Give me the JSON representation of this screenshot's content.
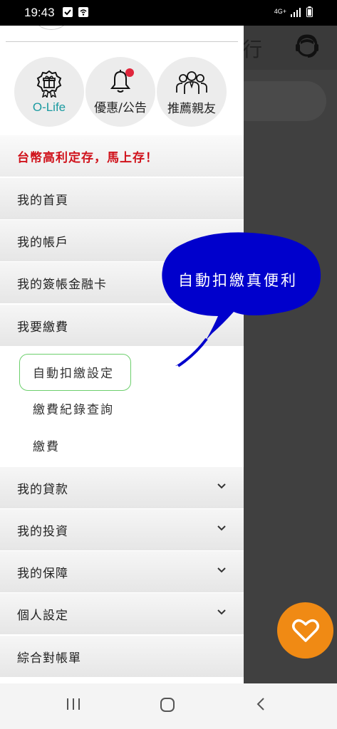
{
  "status": {
    "time": "19:43",
    "network": "4G+"
  },
  "background": {
    "title_fragment": "行"
  },
  "quick_actions": [
    {
      "label": "O-Life",
      "icon": "gift-badge-icon"
    },
    {
      "label": "優惠/公告",
      "icon": "bell-icon"
    },
    {
      "label": "推薦親友",
      "icon": "people-icon"
    }
  ],
  "menu": {
    "promo": "台幣高利定存，馬上存！",
    "home": "我的首頁",
    "accounts": "我的帳戶",
    "debit_card": "我的簽帳金融卡",
    "pay": "我要繳費",
    "sub": [
      "自動扣繳設定",
      "繳費紀錄查詢",
      "繳費"
    ],
    "loans": "我的貸款",
    "investments": "我的投資",
    "insurance": "我的保障",
    "settings": "個人設定",
    "statement": "綜合對帳單"
  },
  "callout": {
    "text": "自動扣繳真便利",
    "color": "#0000cc"
  },
  "colors": {
    "accent": "#f08a14",
    "promo_red": "#d0121b",
    "teal": "#1a9aa0",
    "selection": "#6ccf6c"
  }
}
